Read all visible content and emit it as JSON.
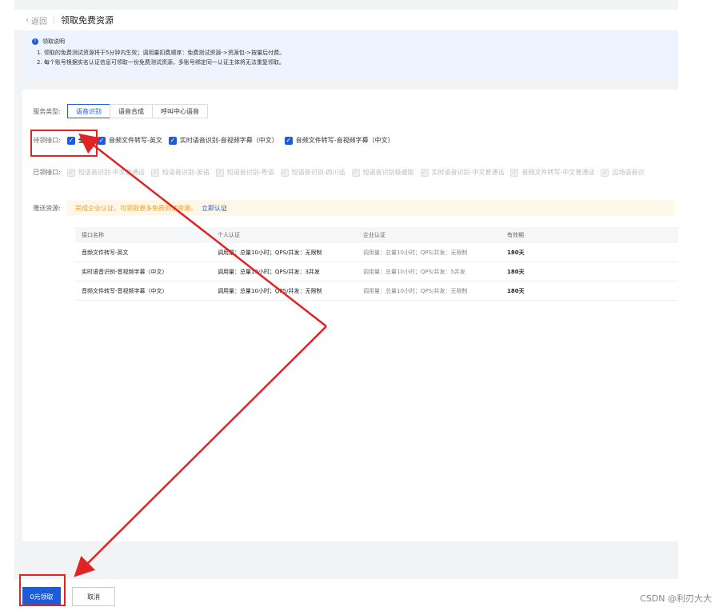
{
  "header": {
    "back_label": "返回",
    "title": "领取免费资源"
  },
  "notice": {
    "heading": "领取说明",
    "lines": [
      "1. 领取的免费测试资源将于5分钟内生效；调用量扣费顺序：免费测试资源->资源包->按量后付费。",
      "2. 每个账号根据实名认证信息可领取一份免费测试资源，多账号绑定同一认证主体将无法重复领取。"
    ]
  },
  "service": {
    "label": "服务类型:",
    "tabs": [
      "语音识别",
      "语音合成",
      "呼叫中心语音"
    ],
    "active_index": 0
  },
  "claimable": {
    "label": "待领接口:",
    "items": [
      "全部",
      "音频文件转写-英文",
      "实时语音识别-音视频字幕（中文）",
      "音频文件转写-音视频字幕（中文）"
    ]
  },
  "claimed": {
    "label": "已领接口:",
    "items": [
      "短语音识别-中文普通话",
      "短语音识别-英语",
      "短语音识别-粤语",
      "短语音识别-四川话",
      "短语音识别极速版",
      "实时语音识别-中文普通话",
      "音频文件转写-中文普通话",
      "远场语音识"
    ]
  },
  "bonus": {
    "label": "赠送资源:",
    "tip": "完成企业认证，可领取更多免费测试资源。",
    "link": "立即认证"
  },
  "table": {
    "headers": [
      "接口名称",
      "个人认证",
      "企业认证",
      "有效期"
    ],
    "rows": [
      [
        "音频文件转写-英文",
        "调用量：总量10小时；QPS/并发：无限制",
        "调用量：总量10小时；QPS/并发：无限制",
        "180天"
      ],
      [
        "实时语音识别-音视频字幕（中文）",
        "调用量：总量10小时；QPS/并发：3并发",
        "调用量：总量10小时；QPS/并发：5并发",
        "180天"
      ],
      [
        "音频文件转写-音视频字幕（中文）",
        "调用量：总量10小时；QPS/并发：无限制",
        "调用量：总量10小时；QPS/并发：无限制",
        "180天"
      ]
    ]
  },
  "footer": {
    "claim_button": "0元领取",
    "cancel_button": "取消"
  },
  "watermark": "CSDN @利刃大大",
  "colors": {
    "primary": "#1e5bd6",
    "annotation": "#e02424",
    "tip": "#f0a020"
  }
}
